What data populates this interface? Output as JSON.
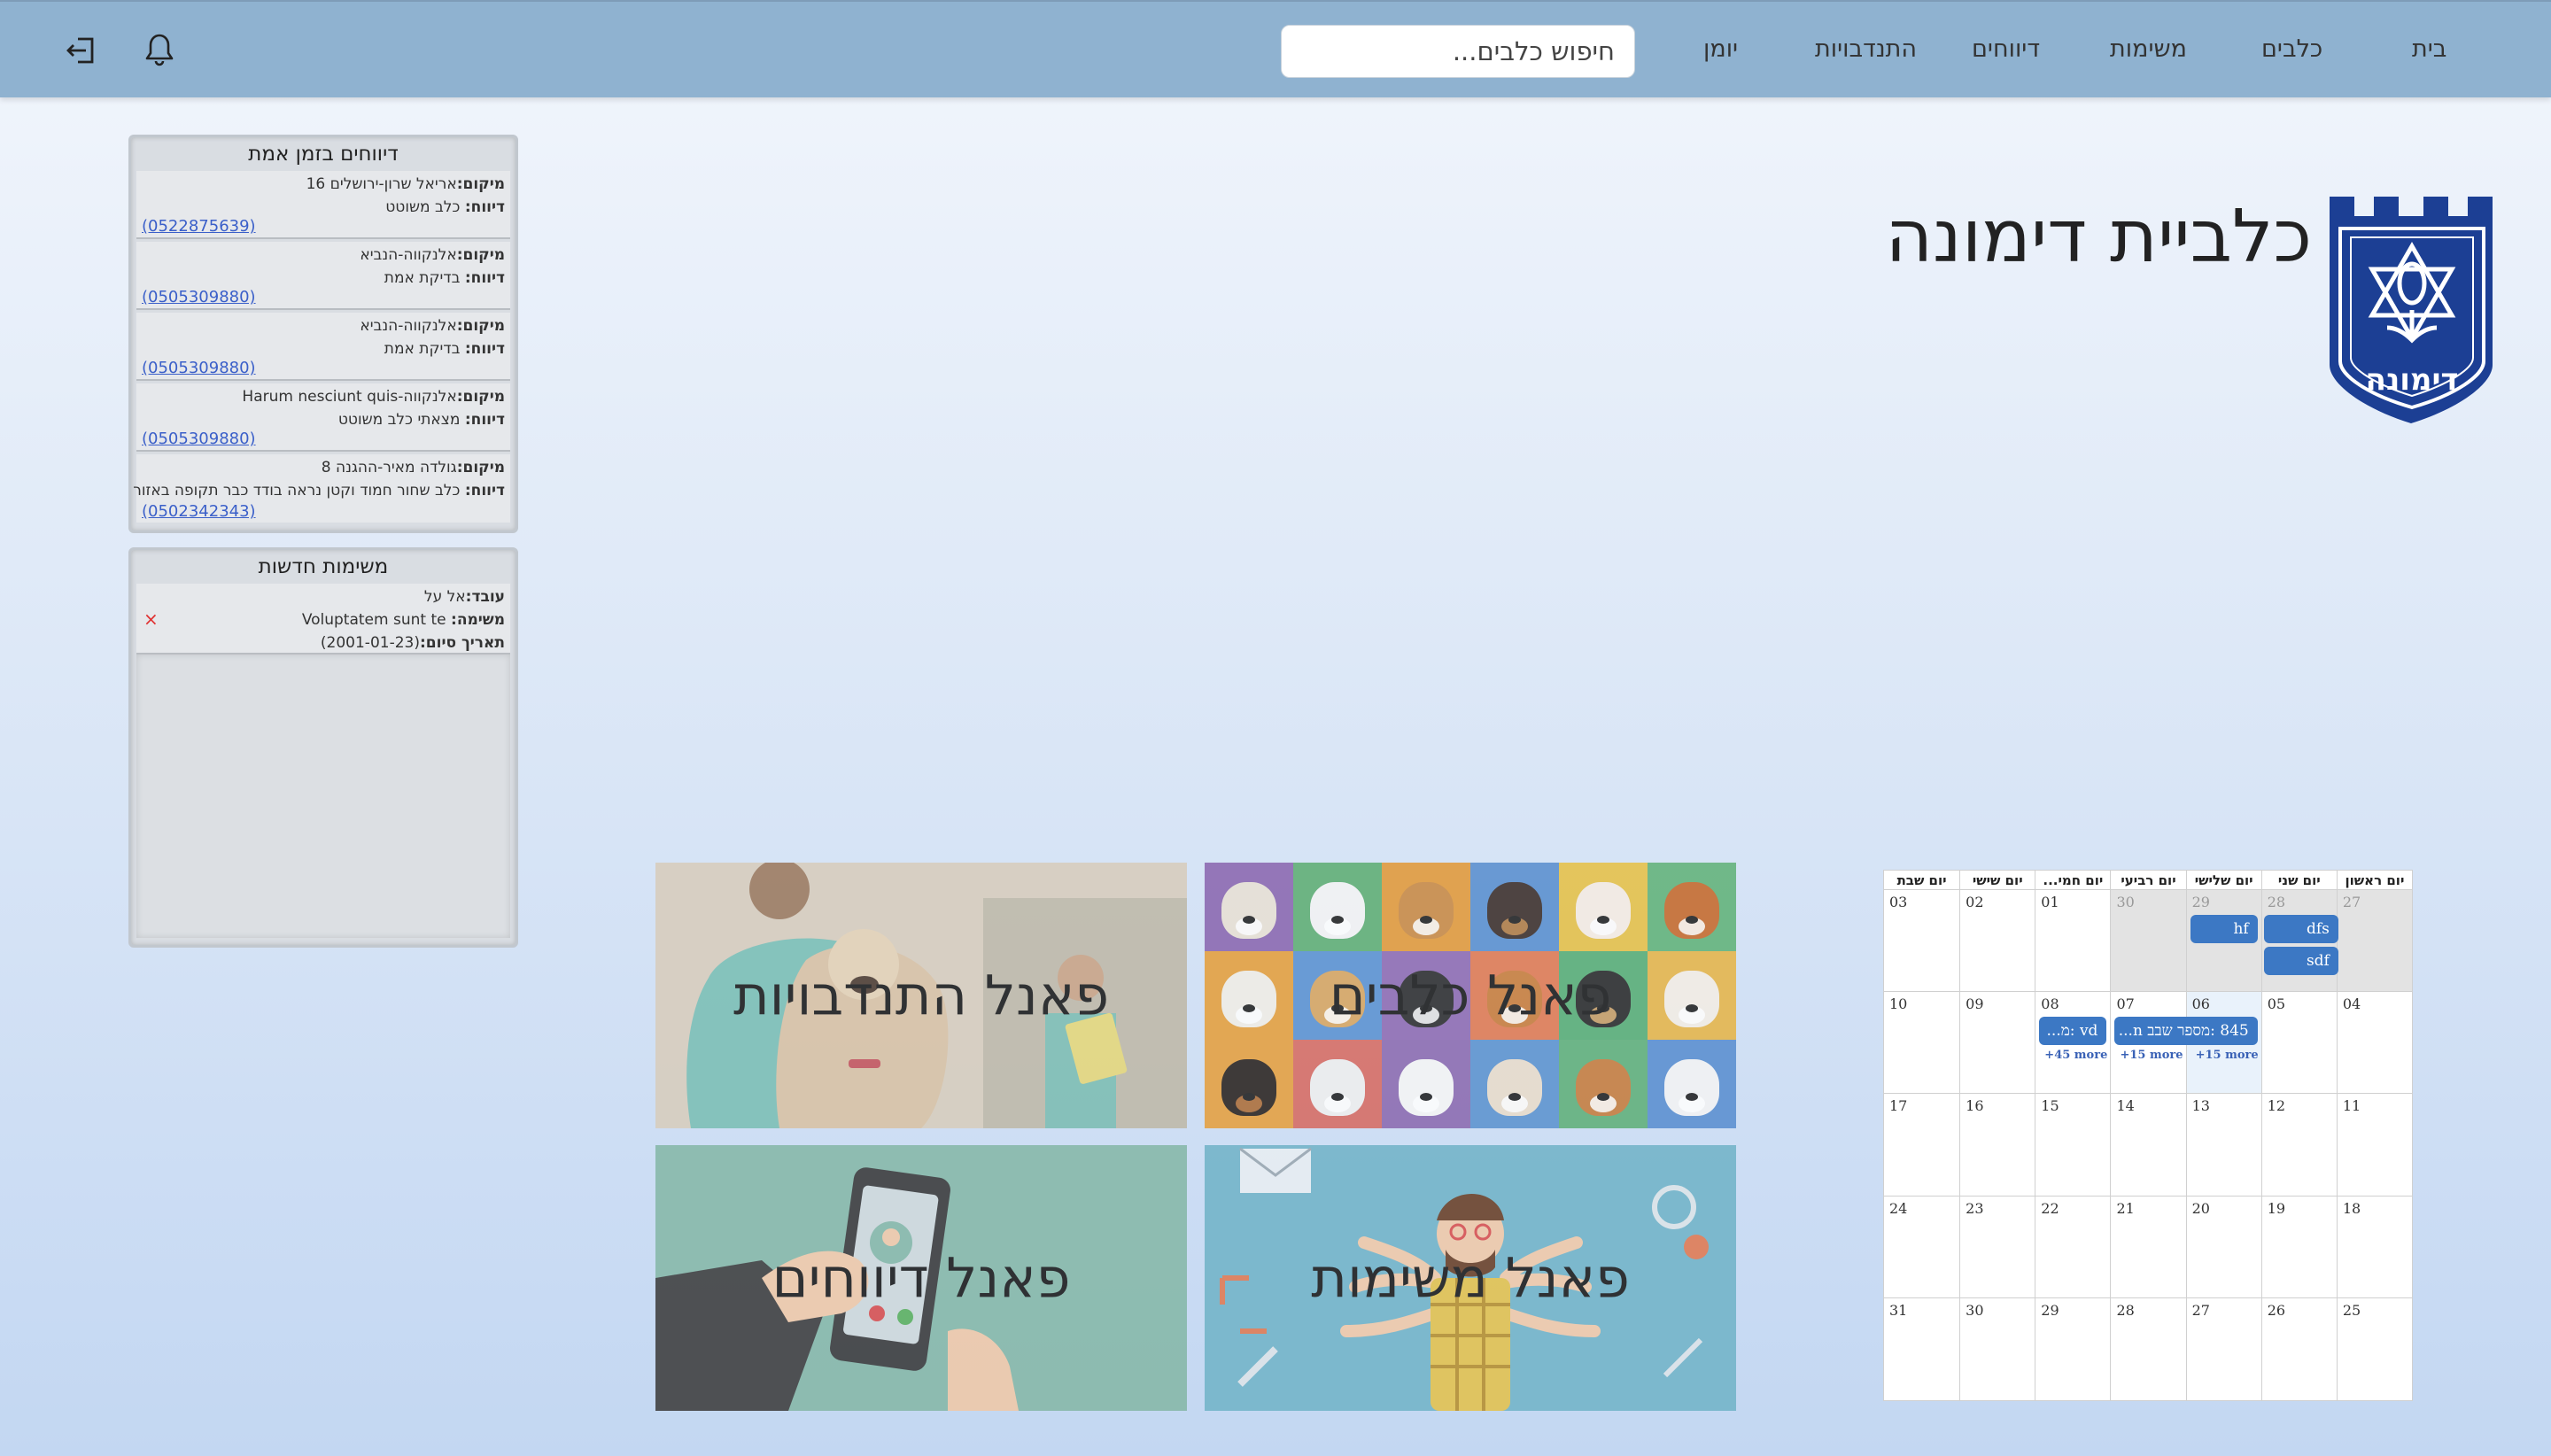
{
  "nav": {
    "items": [
      {
        "label": "בית"
      },
      {
        "label": "כלבים"
      },
      {
        "label": "משימות"
      },
      {
        "label": "דיווחים"
      },
      {
        "label": "התנדבויות"
      },
      {
        "label": "יומן"
      }
    ],
    "search_placeholder": "חיפוש כלבים...",
    "bell_icon": "bell-icon",
    "logout_icon": "logout-icon"
  },
  "reports_panel": {
    "title": "דיווחים בזמן אמת",
    "location_label": "מיקום",
    "report_label": "דיווח",
    "items": [
      {
        "location": "אריאל שרון-ירושלים 16",
        "report": "כלב משוטט",
        "phone": "(0522875639)"
      },
      {
        "location": "אלנקווה-הנביא",
        "report": "בדיקת אמת",
        "phone": "(0505309880)"
      },
      {
        "location": "אלנקווה-הנביא",
        "report": "בדיקת אמת",
        "phone": "(0505309880)"
      },
      {
        "location": "אלנקווה-Harum nesciunt quis",
        "report": "מצאתי כלב משוטט",
        "phone": "(0505309880)"
      },
      {
        "location": "גולדה מאיר-ההגנה 8",
        "report": "כלב שחור חמוד וקטן נראה בודד כבר תקופה באזור",
        "phone": "(0502342343)"
      }
    ]
  },
  "tasks_panel": {
    "title": "משימות חדשות",
    "worker_label": "עובד",
    "task_label": "משימה",
    "due_label": "תאריך סיום",
    "items": [
      {
        "worker": "אל על",
        "task": "Voluptatem sunt te",
        "due": "(2001-01-23)",
        "delete": "×"
      }
    ]
  },
  "header": {
    "title": "כלביית דימונה",
    "logo_text": "דימונה"
  },
  "tiles": [
    {
      "label": "פאנל התנדבויות"
    },
    {
      "label": "פאנל כלבים"
    },
    {
      "label": "פאנל דיווחים"
    },
    {
      "label": "פאנל משימות"
    }
  ],
  "calendar": {
    "weekdays": [
      "יום ראשון",
      "יום שני",
      "יום שלישי",
      "יום רביעי",
      "יום חמי...",
      "יום שישי",
      "יום שבת"
    ],
    "weeks": [
      [
        "27",
        "28",
        "29",
        "30",
        "01",
        "02",
        "03"
      ],
      [
        "04",
        "05",
        "06",
        "07",
        "08",
        "09",
        "10"
      ],
      [
        "11",
        "12",
        "13",
        "14",
        "15",
        "16",
        "17"
      ],
      [
        "18",
        "19",
        "20",
        "21",
        "22",
        "23",
        "24"
      ],
      [
        "25",
        "26",
        "27",
        "28",
        "29",
        "30",
        "31"
      ]
    ],
    "events": {
      "dfs": "dfs",
      "sdf": "sdf",
      "hf": "hf",
      "e845": "845 :מספר שבב n...",
      "vd": "vd :מ...",
      "more1": "+15 more",
      "more2": "+15 more",
      "more3": "+45 more"
    }
  },
  "colors": {
    "navbar": "#8fb2d0",
    "event": "#3c78c4",
    "link": "#3a5fc9",
    "logo": "#1c3f94"
  }
}
